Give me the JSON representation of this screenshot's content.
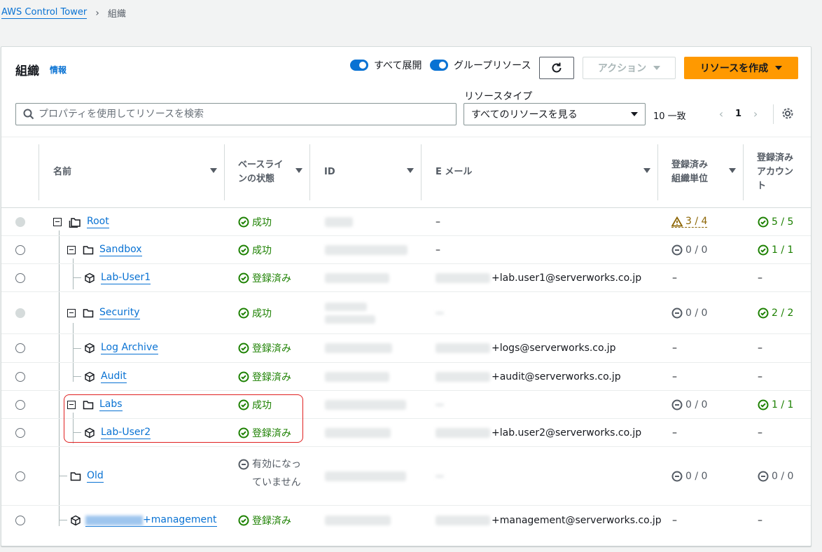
{
  "breadcrumb": {
    "root": "AWS Control Tower",
    "current": "組織"
  },
  "header": {
    "title": "組織",
    "info": "情報",
    "toggle_expand": "すべて展開",
    "toggle_group": "グループリソース",
    "action_label": "アクション",
    "create_label": "リソースを作成"
  },
  "filter": {
    "search_placeholder": "プロパティを使用してリソースを検索",
    "rtype_label": "リソースタイプ",
    "rtype_value": "すべてのリソースを見る",
    "match": "10 一致",
    "page": "1"
  },
  "columns": {
    "name": "名前",
    "baseline": "ベースラインの状態",
    "id": "ID",
    "email": "E メール",
    "ou": "登録済み組織単位",
    "acct": "登録済みアカウント"
  },
  "rows": [
    {
      "name": "Root",
      "status": "成功",
      "email": "–",
      "ou": "3 / 4",
      "acct": "5 / 5"
    },
    {
      "name": "Sandbox",
      "status": "成功",
      "email": "–",
      "ou": "0 / 0",
      "acct": "1 / 1"
    },
    {
      "name": "Lab-User1",
      "status": "登録済み",
      "email": "+lab.user1@serverworks.co.jp",
      "ou": "–",
      "acct": "–"
    },
    {
      "name": "Security",
      "status": "成功",
      "email": "",
      "ou": "0 / 0",
      "acct": "2 / 2"
    },
    {
      "name": "Log Archive",
      "status": "登録済み",
      "email": "+logs@serverworks.co.jp",
      "ou": "–",
      "acct": "–"
    },
    {
      "name": "Audit",
      "status": "登録済み",
      "email": "+audit@serverworks.co.jp",
      "ou": "–",
      "acct": "–"
    },
    {
      "name": "Labs",
      "status": "成功",
      "email": "",
      "ou": "0 / 0",
      "acct": "1 / 1"
    },
    {
      "name": "Lab-User2",
      "status": "登録済み",
      "email": "+lab.user2@serverworks.co.jp",
      "ou": "–",
      "acct": "–"
    },
    {
      "name": "Old",
      "status": "有効になっていません",
      "email": "",
      "ou": "0 / 0",
      "acct": "0 / 0"
    },
    {
      "name": "+management",
      "status": "登録済み",
      "email": "+management@serverworks.co.jp",
      "ou": "–",
      "acct": "–"
    }
  ],
  "colors": {
    "accent": "#0972d3",
    "success": "#1d8102",
    "warning": "#8d6605",
    "primary_button": "#ff9900"
  }
}
